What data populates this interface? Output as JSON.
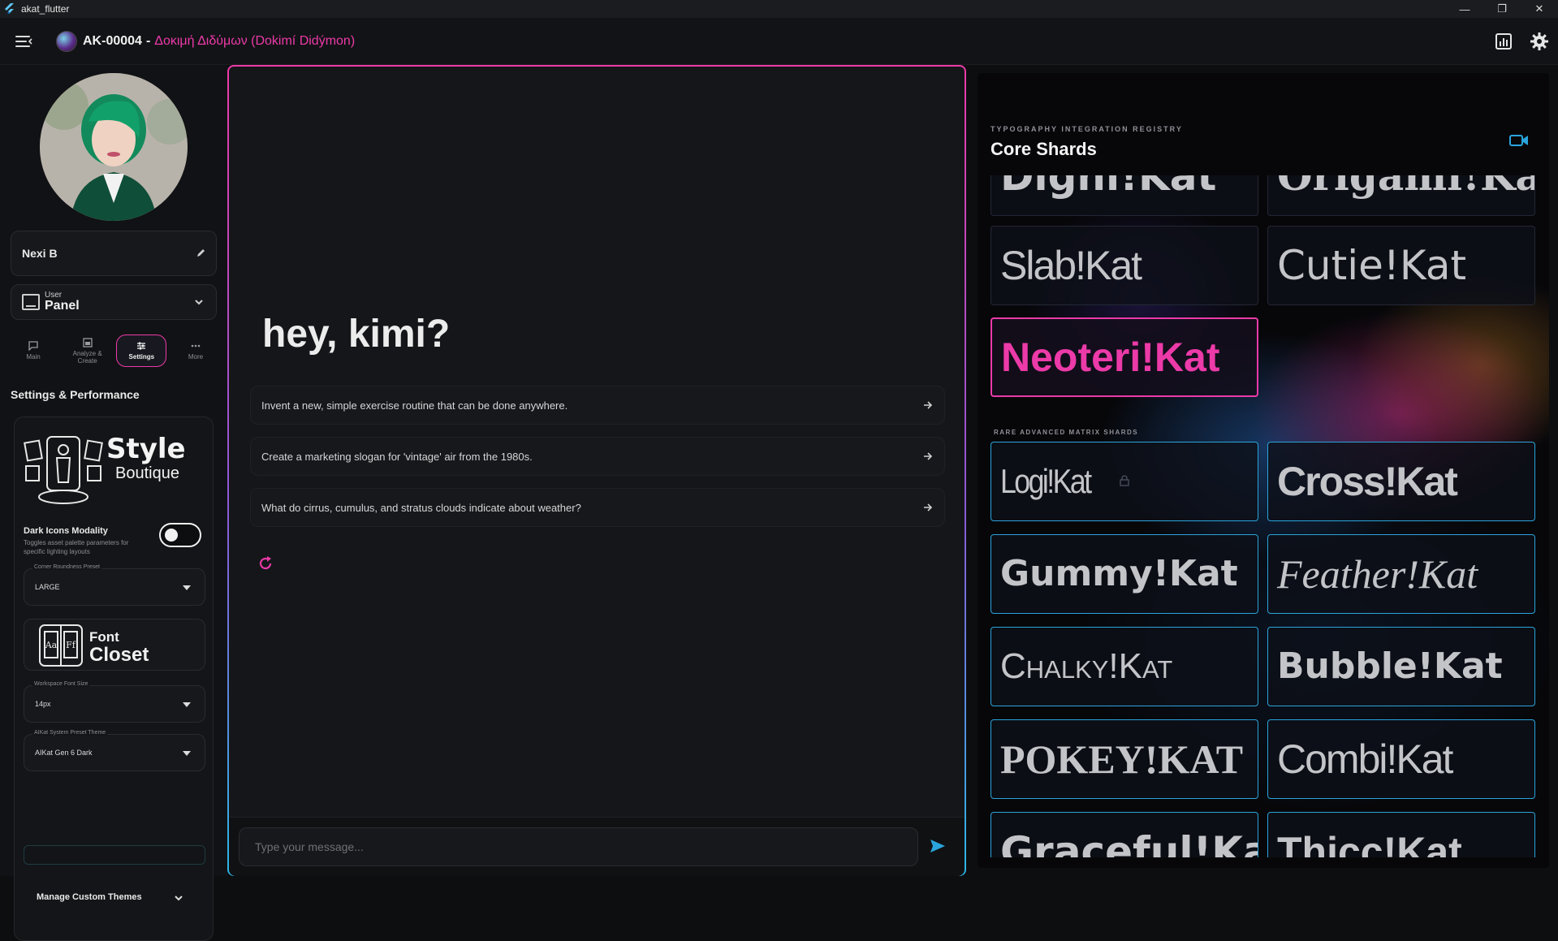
{
  "window": {
    "title": "akat_flutter",
    "minimize": "—",
    "restore": "❐",
    "close": "✕"
  },
  "header": {
    "id": "AK-00004",
    "separator": "-",
    "subtitle": "Δοκιμή Διδύμων (Dokimí Didýmon)",
    "icons": [
      "stats-icon",
      "gear-icon"
    ]
  },
  "sidebar": {
    "user_name": "Nexi B",
    "panel_select": {
      "small": "User",
      "big": "Panel"
    },
    "tabs": [
      {
        "label": "Main",
        "icon": "chat-icon",
        "active": false
      },
      {
        "label": "Analyze & Create",
        "icon": "image-icon",
        "active": false
      },
      {
        "label": "Settings",
        "icon": "sliders-icon",
        "active": true
      },
      {
        "label": "More",
        "icon": "dots-icon",
        "active": false
      }
    ],
    "settings_heading": "Settings & Performance",
    "boutique": {
      "line1": "Style",
      "line2": "Boutique"
    },
    "dark_icons": {
      "label": "Dark Icons Modality",
      "description": "Toggles asset palette parameters for specific lighting layouts",
      "enabled": false
    },
    "corner_roundness": {
      "legend": "Corner Roundness Preset",
      "value": "LARGE"
    },
    "font_closet": {
      "line1": "Font",
      "line2": "Closet"
    },
    "workspace_font_size": {
      "legend": "Workspace Font Size",
      "value": "14px"
    },
    "theme": {
      "legend": "AIKat System Preset Theme",
      "value": "AIKat Gen 6 Dark"
    },
    "manage_themes": "Manage Custom Themes"
  },
  "chat": {
    "greeting": "hey, kimi?",
    "suggestions": [
      "Invent a new, simple exercise routine that can be done anywhere.",
      "Create a marketing slogan for 'vintage' air from the 1980s.",
      "What do cirrus, cumulus, and stratus clouds indicate about weather?"
    ],
    "input_placeholder": "Type your message..."
  },
  "font_panel": {
    "registry_label": "TYPOGRAPHY INTEGRATION REGISTRY",
    "title": "Core Shards",
    "rare_label": "RARE ADVANCED MATRIX SHARDS",
    "core_tiles": [
      "Digni!Kat",
      "Origami!Kat",
      "Slab!Kat",
      "Cutie!Kat",
      "Neoteri!Kat"
    ],
    "rare_tiles": [
      "Logi!Kat",
      "Cross!Kat",
      "Gummy!Kat",
      "Feather!Kat",
      "Chalky!Kat",
      "Bubble!Kat",
      "Pokey!Kat",
      "Combi!Kat",
      "Graceful!Kat",
      "Thicc!Kat"
    ],
    "accent_pink": "#ec3aa8",
    "accent_cyan": "#2aa4dc"
  }
}
